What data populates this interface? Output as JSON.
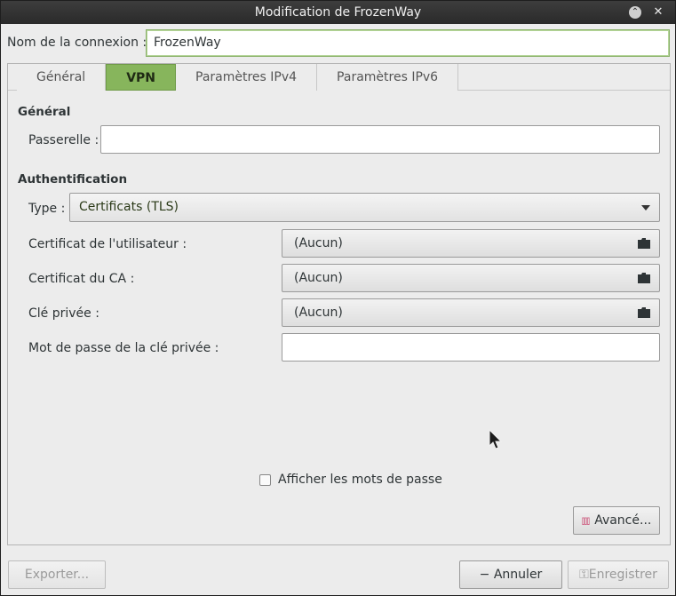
{
  "window": {
    "title": "Modification de FrozenWay"
  },
  "connection": {
    "label": "Nom de la connexion :",
    "value": "FrozenWay"
  },
  "tabs": [
    {
      "label": "Général"
    },
    {
      "label": "VPN"
    },
    {
      "label": "Paramètres IPv4"
    },
    {
      "label": "Paramètres IPv6"
    }
  ],
  "general": {
    "heading": "Général",
    "gateway_label": "Passerelle :",
    "gateway_value": ""
  },
  "auth": {
    "heading": "Authentification",
    "type_label": "Type :",
    "type_value": "Certificats (TLS)",
    "user_cert_label": "Certificat de l'utilisateur :",
    "user_cert_value": "(Aucun)",
    "ca_cert_label": "Certificat du CA :",
    "ca_cert_value": "(Aucun)",
    "private_key_label": "Clé privée :",
    "private_key_value": "(Aucun)",
    "key_password_label": "Mot de passe de la clé privée :",
    "key_password_value": ""
  },
  "show_passwords": {
    "label": "Afficher les mots de passe",
    "checked": false
  },
  "buttons": {
    "advanced": "Avancé...",
    "export": "Exporter...",
    "cancel": "Annuler",
    "save": "Enregistrer"
  },
  "colors": {
    "accent": "#87b55c",
    "focus_border": "#8ab06a"
  }
}
